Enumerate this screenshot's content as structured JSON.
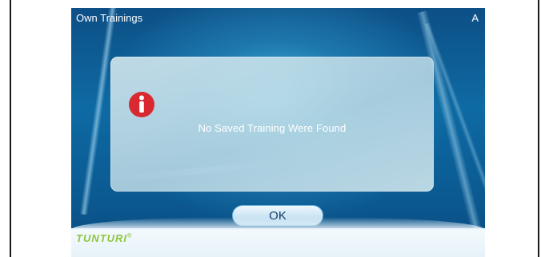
{
  "screen": {
    "title": "Own Trainings",
    "user_indicator": "A"
  },
  "dialog": {
    "icon": "info-icon",
    "message": "No Saved Training Were Found",
    "ok_label": "OK"
  },
  "brand": {
    "name": "TUNTURI",
    "mark": "®",
    "color": "#8cc63f"
  },
  "colors": {
    "screen_blue": "#0e6aa3",
    "icon_red": "#d9282f",
    "ok_text": "#0f3b66"
  }
}
